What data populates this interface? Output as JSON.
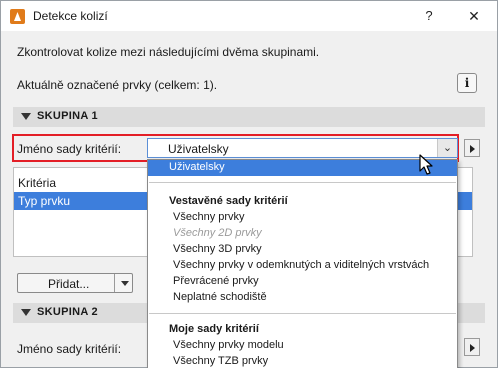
{
  "window": {
    "title": "Detekce kolizí",
    "help_label": "?",
    "close_label": "✕"
  },
  "main": {
    "description": "Zkontrolovat kolize mezi následujícími dvěma skupinami.",
    "selected_count": "Aktuálně označené prvky (celkem: 1).",
    "info_label": "i"
  },
  "group1": {
    "header": "SKUPINA 1",
    "criteria_set_label": "Jméno sady kritérií:",
    "criteria_set_value": "Uživatelsky",
    "table": {
      "column_header": "Kritéria",
      "rows": [
        "Typ prvku"
      ]
    },
    "add_button": "Přidat..."
  },
  "group2": {
    "header": "SKUPINA 2",
    "criteria_set_label": "Jméno sady kritérií:"
  },
  "dropdown": {
    "selected": "Uživatelsky",
    "builtin_group": "Vestavěné sady kritérií",
    "builtin_items": [
      "Všechny prvky",
      "Všechny 2D prvky",
      "Všechny 3D prvky",
      "Všechny prvky v odemknutých a viditelných vrstvách",
      "Převrácené prvky",
      "Neplatné schodiště"
    ],
    "my_group": "Moje sady kritérií",
    "my_items": [
      "Všechny prvky modelu",
      "Všechny TZB prvky"
    ]
  },
  "colors": {
    "accent": "#3d7edc",
    "highlight_border": "#e31e26",
    "window_bg": "#f0f0f0"
  }
}
